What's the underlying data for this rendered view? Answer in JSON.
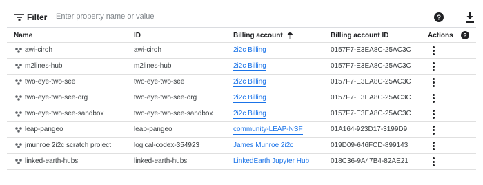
{
  "filter": {
    "label": "Filter",
    "placeholder": "Enter property name or value"
  },
  "icons": {
    "filter": "filter-icon",
    "help": "help-icon",
    "download": "download-icon",
    "project": "project-icon",
    "more": "more-vert-icon",
    "sort": "arrow-up-icon"
  },
  "table": {
    "headers": {
      "name": "Name",
      "id": "ID",
      "billing_account": "Billing account",
      "billing_account_id": "Billing account ID",
      "actions": "Actions"
    },
    "sort_column": "Billing account",
    "rows": [
      {
        "name": "awi-ciroh",
        "id": "awi-ciroh",
        "billing": "2i2c Billing",
        "billing_id": "0157F7-E3EA8C-25AC3C"
      },
      {
        "name": "m2lines-hub",
        "id": "m2lines-hub",
        "billing": "2i2c Billing",
        "billing_id": "0157F7-E3EA8C-25AC3C"
      },
      {
        "name": "two-eye-two-see",
        "id": "two-eye-two-see",
        "billing": "2i2c Billing",
        "billing_id": "0157F7-E3EA8C-25AC3C"
      },
      {
        "name": "two-eye-two-see-org",
        "id": "two-eye-two-see-org",
        "billing": "2i2c Billing",
        "billing_id": "0157F7-E3EA8C-25AC3C"
      },
      {
        "name": "two-eye-two-see-sandbox",
        "id": "two-eye-two-see-sandbox",
        "billing": "2i2c Billing",
        "billing_id": "0157F7-E3EA8C-25AC3C"
      },
      {
        "name": "leap-pangeo",
        "id": "leap-pangeo",
        "billing": "community-LEAP-NSF",
        "billing_id": "01A164-923D17-3199D9"
      },
      {
        "name": "jmunroe 2i2c scratch project",
        "id": "logical-codex-354923",
        "billing": "James Munroe 2i2c",
        "billing_id": "019D09-646FCD-899143"
      },
      {
        "name": "linked-earth-hubs",
        "id": "linked-earth-hubs",
        "billing": "LinkedEarth Jupyter Hub",
        "billing_id": "018C36-9A47B4-82AE21"
      }
    ]
  },
  "colors": {
    "link": "#1a73e8",
    "text": "#202124",
    "border": "#e0e0e0"
  }
}
